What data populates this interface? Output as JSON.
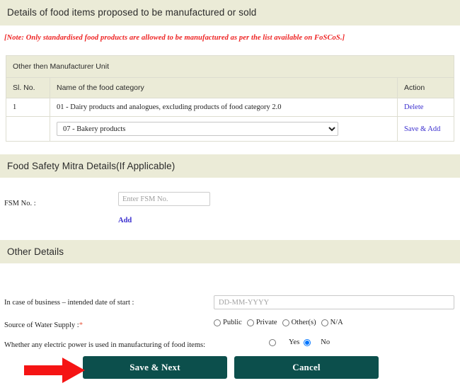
{
  "page": {
    "section_food_items_title": "Details of food items proposed to be manufactured or sold",
    "note": "[Note: Only standardised food products are allowed to be manufactured as per the list available on FoSCoS.]"
  },
  "food_table": {
    "caption": "Other then Manufacturer Unit",
    "columns": [
      "Sl. No.",
      "Name of the food category",
      "Action"
    ],
    "rows": [
      {
        "sl_no": "1",
        "category": "01 - Dairy products and analogues, excluding products of food category 2.0",
        "action": "Delete"
      }
    ],
    "new_row": {
      "sl_no": "",
      "selected_category": "07 - Bakery products",
      "options": [
        "07 - Bakery products"
      ],
      "action": "Save & Add"
    }
  },
  "fsm": {
    "section_title": "Food Safety Mitra Details(If Applicable)",
    "label": "FSM No. :",
    "placeholder": "Enter FSM No.",
    "value": "",
    "add_label": "Add"
  },
  "other_details": {
    "section_title": "Other Details",
    "start_date": {
      "label": "In case of business – intended date of start :",
      "placeholder": "DD-MM-YYYY",
      "value": ""
    },
    "water_supply": {
      "label": "Source of Water Supply :",
      "required_mark": "*",
      "options": [
        "Public",
        "Private",
        "Other(s)",
        "N/A"
      ],
      "selected": ""
    },
    "electric_power": {
      "label": "Whether any electric power is used in manufacturing of food items:",
      "options": [
        "Yes",
        "No"
      ],
      "selected": "No"
    }
  },
  "actions": {
    "save_next": "Save & Next",
    "cancel": "Cancel"
  },
  "annotation": {
    "arrow_color": "#f51414",
    "arrow_target": "save-next-button"
  },
  "colors": {
    "section_bar_bg": "#ebebd7",
    "button_bg": "#0c4f4c",
    "link": "#3b2fcf",
    "note_red": "#ee2222",
    "required_star": "#e8593f",
    "radio_selected": "#1a73e8"
  }
}
